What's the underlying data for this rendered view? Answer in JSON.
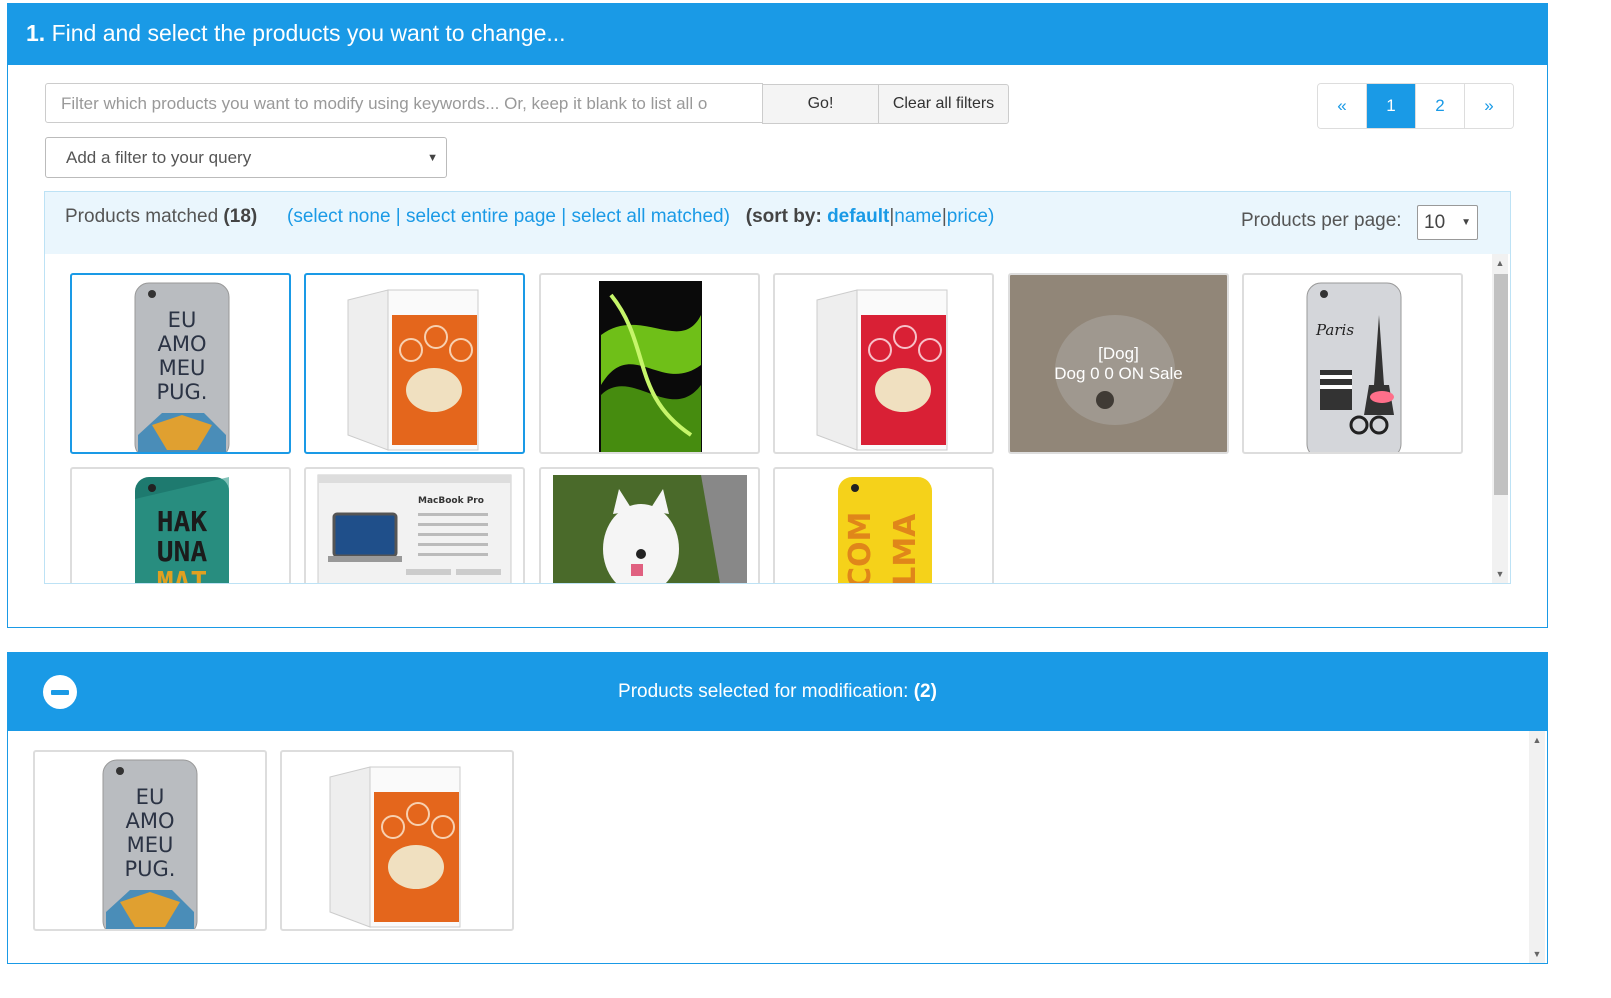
{
  "step1": {
    "number": "1.",
    "title": "Find and select the products you want to change..."
  },
  "search": {
    "placeholder": "Filter which products you want to modify using keywords... Or, keep it blank to list all o",
    "go_label": "Go!",
    "clear_label": "Clear all filters"
  },
  "filter_select": {
    "selected": "Add a filter to your query"
  },
  "pagination": {
    "prev": "«",
    "pages": [
      "1",
      "2"
    ],
    "next": "»",
    "current": "1"
  },
  "matched": {
    "label": "Products matched",
    "count": "(18)",
    "open": "(",
    "select_none": "select none",
    "sep": "|",
    "select_page": "select entire page",
    "select_all": "select all matched",
    "close": ")",
    "sort_open": "(",
    "sort_label": "sort by:",
    "sort_default": "default",
    "sort_name": "name",
    "sort_price": "price",
    "sort_close": ")",
    "per_page_label": "Products per page:",
    "per_page_value": "10"
  },
  "products": [
    {
      "image": "phone-case-eu-amo-meu-pug",
      "selected": true
    },
    {
      "image": "pet-box-orange-paw",
      "selected": true
    },
    {
      "image": "green-abstract-swirl",
      "selected": false
    },
    {
      "image": "pet-box-red-paw",
      "selected": false
    },
    {
      "image": "white-dog-photo",
      "selected": false,
      "hover_category": "[Dog]",
      "hover_name": "Dog 0 0 ON Sale"
    },
    {
      "image": "phone-case-paris",
      "selected": false
    },
    {
      "image": "phone-case-hakuna-matata",
      "selected": false
    },
    {
      "image": "macbook-pro-about-screen",
      "selected": false
    },
    {
      "image": "white-dog-on-grass",
      "selected": false
    },
    {
      "image": "phone-case-com-alma",
      "selected": false
    }
  ],
  "phone_case_text": {
    "pug": [
      "EU",
      "AMO",
      "MEU",
      "PUG."
    ],
    "hakuna": [
      "HAK",
      "UNA",
      "MAT"
    ],
    "alma": [
      "COM",
      "ALMA"
    ],
    "paris": "Paris"
  },
  "macbook_text": "MacBook Pro",
  "selected_panel": {
    "label": "Products selected for modification:",
    "count": "(2)"
  },
  "selected_products": [
    {
      "image": "phone-case-eu-amo-meu-pug"
    },
    {
      "image": "pet-box-orange-paw"
    }
  ],
  "colors": {
    "accent": "#1a9ae6",
    "header_text": "#ffffff",
    "pale_blue": "#eaf6fd"
  }
}
